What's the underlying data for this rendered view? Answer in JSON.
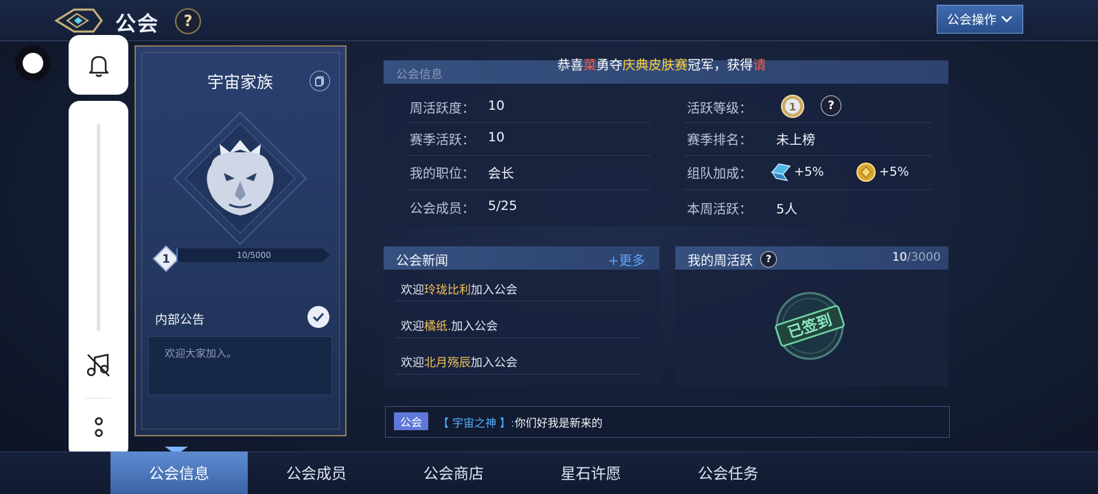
{
  "header": {
    "title": "公会",
    "help_label": "?",
    "ops_label": "公会操作"
  },
  "guild": {
    "name": "宇宙家族",
    "level": "1",
    "progress_text": "10/5000",
    "progress_fraction": 0.002,
    "notice_title": "内部公告",
    "notice_text": "欢迎大家加入。"
  },
  "marquee": {
    "prefix": "恭喜",
    "player": "菜",
    "middle": "勇夺",
    "event": "庆典皮肤赛",
    "suffix": "冠军，获得",
    "tail": "请"
  },
  "info": {
    "section_title": "公会信息",
    "weekly_activity_label": "周活跃度：",
    "weekly_activity_value": "10",
    "season_activity_label": "赛季活跃：",
    "season_activity_value": "10",
    "my_position_label": "我的职位：",
    "my_position_value": "会长",
    "members_label": "公会成员：",
    "members_value": "5/25",
    "activity_level_label": "活跃等级：",
    "activity_level_badge": "1",
    "season_rank_label": "赛季排名：",
    "season_rank_value": "未上榜",
    "team_bonus_label": "组队加成：",
    "team_bonus_1": "+5%",
    "team_bonus_2": "+5%",
    "week_active_label": "本周活跃：",
    "week_active_value": "5人"
  },
  "news": {
    "title": "公会新闻",
    "more_label": "更多",
    "items": [
      {
        "prefix": "欢迎",
        "name": "玲珑比利",
        "suffix": "加入公会"
      },
      {
        "prefix": "欢迎",
        "name": "橘纸.",
        "suffix": "加入公会"
      },
      {
        "prefix": "欢迎",
        "name": "北月殇辰",
        "suffix": "加入公会"
      }
    ]
  },
  "weekly": {
    "title": "我的周活跃",
    "current": "10",
    "total": "/3000",
    "stamp_text": "已签到"
  },
  "chat": {
    "tag": "公会",
    "sender": "【 宇宙之神 】:",
    "message": "你们好我是新来的"
  },
  "tabs": [
    {
      "label": "公会信息",
      "active": true
    },
    {
      "label": "公会成员",
      "active": false
    },
    {
      "label": "公会商店",
      "active": false
    },
    {
      "label": "星石许愿",
      "active": false
    },
    {
      "label": "公会任务",
      "active": false
    }
  ],
  "colors": {
    "accent_blue": "#4a78c2",
    "gold": "#f2c25a",
    "link_blue": "#5fa6ff",
    "stamp_green": "#56c48f"
  }
}
